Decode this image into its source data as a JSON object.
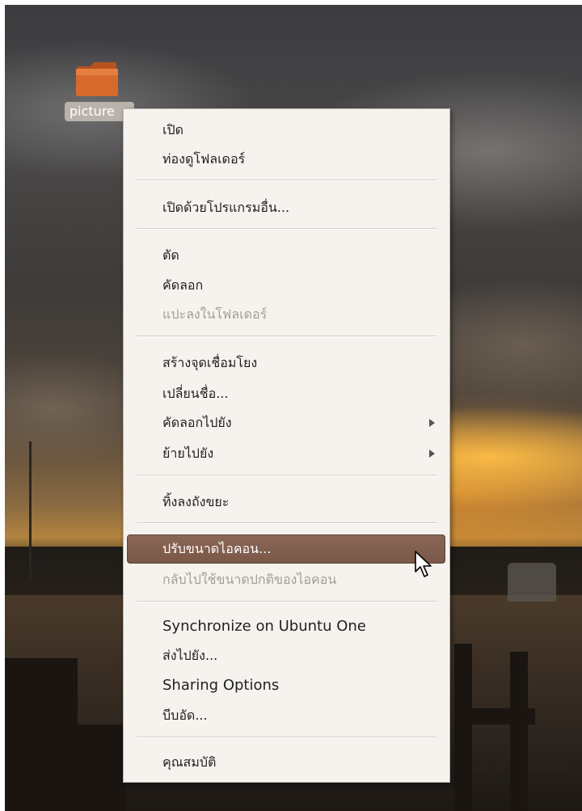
{
  "desktop": {
    "icons": [
      {
        "name": "pictures",
        "label": "picture"
      }
    ]
  },
  "context_menu": {
    "highlighted_item": "ปรับขนาดไอคอน...",
    "items": [
      {
        "label": "เปิด",
        "enabled": true
      },
      {
        "label": "ท่องดูโฟลเดอร์",
        "enabled": true
      },
      {
        "label": "เปิดด้วยโปรแกรมอื่น...",
        "enabled": true
      },
      {
        "label": "ตัด",
        "enabled": true
      },
      {
        "label": "คัดลอก",
        "enabled": true
      },
      {
        "label": "แปะลงในโฟลเดอร์",
        "enabled": false
      },
      {
        "label": "สร้างจุดเชื่อมโยง",
        "enabled": true
      },
      {
        "label": "เปลี่ยนชื่อ...",
        "enabled": true
      },
      {
        "label": "คัดลอกไปยัง",
        "enabled": true,
        "submenu": true
      },
      {
        "label": "ย้ายไปยัง",
        "enabled": true,
        "submenu": true
      },
      {
        "label": "ทิ้งลงถังขยะ",
        "enabled": true
      },
      {
        "label": "ปรับขนาดไอคอน...",
        "enabled": true,
        "highlighted": true
      },
      {
        "label": "กลับไปใช้ขนาดปกติของไอคอน",
        "enabled": false
      },
      {
        "label": "Synchronize on Ubuntu One",
        "enabled": true
      },
      {
        "label": "ส่งไปยัง...",
        "enabled": true
      },
      {
        "label": "Sharing Options",
        "enabled": true
      },
      {
        "label": "บีบอัด...",
        "enabled": true
      },
      {
        "label": "คุณสมบัติ",
        "enabled": true
      }
    ]
  },
  "colors": {
    "menu_background": "#f6f3ee",
    "highlight": "#7e5c4c",
    "disabled_text": "#a19d97",
    "folder_orange": "#d4652a"
  },
  "icons": {
    "folder": "folder-icon",
    "submenu": "submenu-arrow-icon",
    "pointer": "mouse-pointer-icon"
  }
}
